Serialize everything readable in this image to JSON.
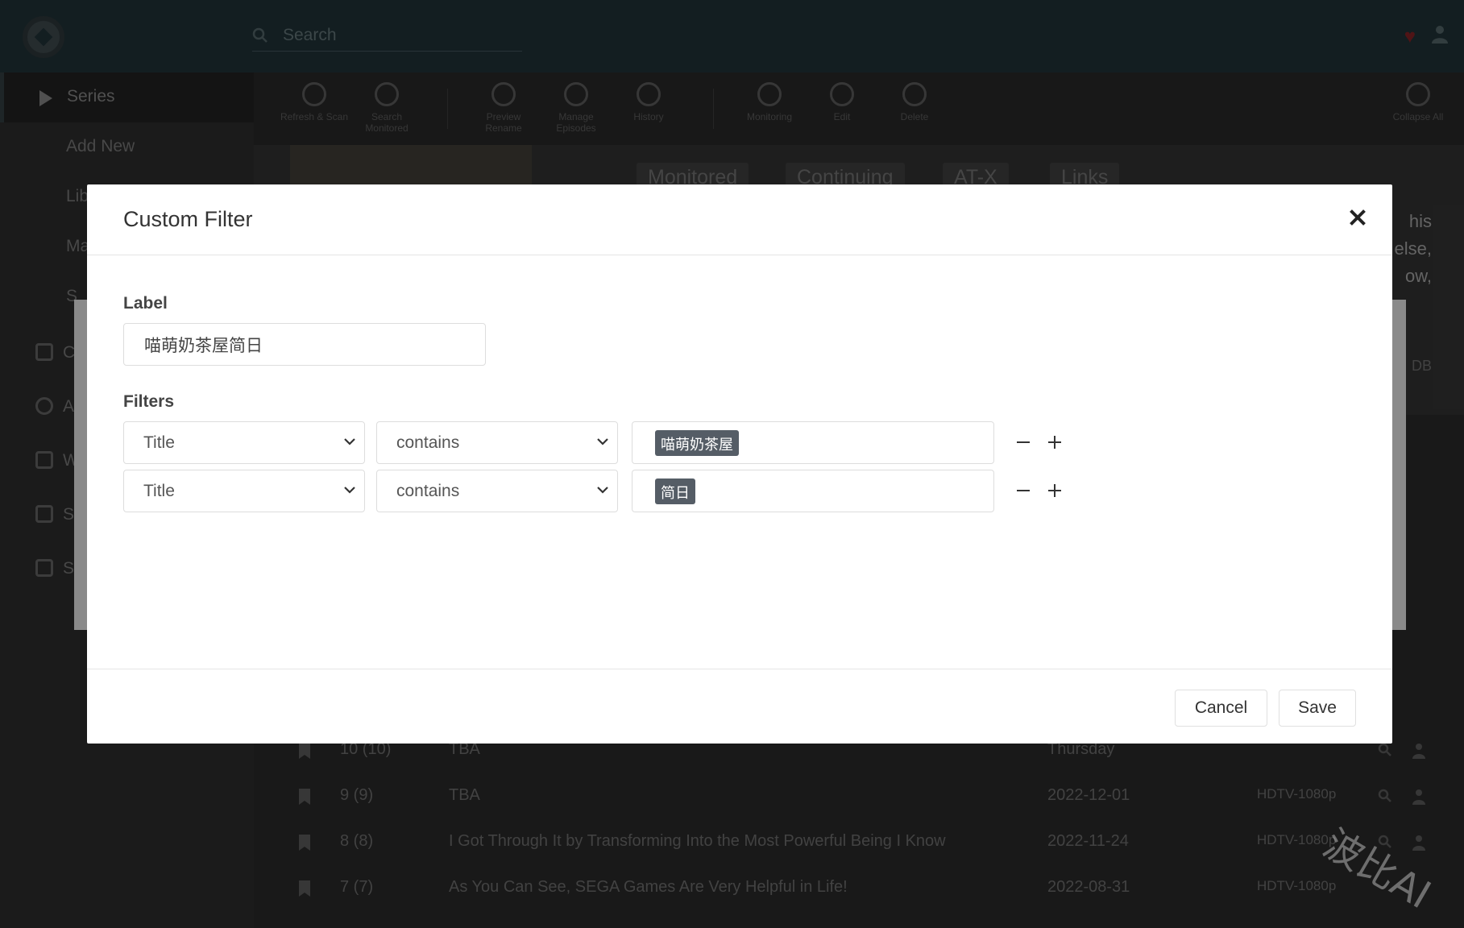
{
  "app": {
    "search_placeholder": "Search",
    "sidebar": [
      {
        "label": "Series"
      },
      {
        "label": "Add New"
      },
      {
        "label": "Lib"
      },
      {
        "label": "Ma"
      },
      {
        "label": "S"
      },
      {
        "label": "C"
      },
      {
        "label": "A"
      },
      {
        "label": "W"
      },
      {
        "label": "S"
      },
      {
        "label": "S"
      }
    ],
    "toolbar": [
      {
        "label": "Refresh & Scan"
      },
      {
        "label": "Search Monitored"
      },
      {
        "label": "Preview Rename"
      },
      {
        "label": "Manage Episodes"
      },
      {
        "label": "History"
      },
      {
        "label": "Monitoring"
      },
      {
        "label": "Edit"
      },
      {
        "label": "Delete"
      },
      {
        "label": "Collapse All"
      }
    ],
    "hero": {
      "labels": [
        "Monitored",
        "Continuing",
        "AT-X",
        "Links"
      ],
      "text_fragments": [
        "his",
        "else,",
        "ow,",
        "DB"
      ]
    },
    "episodes": [
      {
        "number": "10 (10)",
        "title": "TBA",
        "date": "Thursday",
        "quality": ""
      },
      {
        "number": "9 (9)",
        "title": "TBA",
        "date": "2022-12-01",
        "quality": "HDTV-1080p"
      },
      {
        "number": "8 (8)",
        "title": "I Got Through It by Transforming Into the Most Powerful Being I Know",
        "date": "2022-11-24",
        "quality": "HDTV-1080p"
      },
      {
        "number": "7 (7)",
        "title": "As You Can See, SEGA Games Are Very Helpful in Life!",
        "date": "2022-08-31",
        "quality": "HDTV-1080p"
      }
    ]
  },
  "modal": {
    "title": "Custom Filter",
    "label_heading": "Label",
    "label_value": "喵萌奶茶屋简日",
    "filters_heading": "Filters",
    "filters": [
      {
        "field": "Title",
        "operator": "contains",
        "value": "喵萌奶茶屋"
      },
      {
        "field": "Title",
        "operator": "contains",
        "value": "简日"
      }
    ],
    "cancel_label": "Cancel",
    "save_label": "Save"
  },
  "watermark": "波比AI",
  "colors": {
    "topbar": "#1e2f33",
    "tag_bg": "#555d66",
    "heart": "#7a1f23"
  }
}
